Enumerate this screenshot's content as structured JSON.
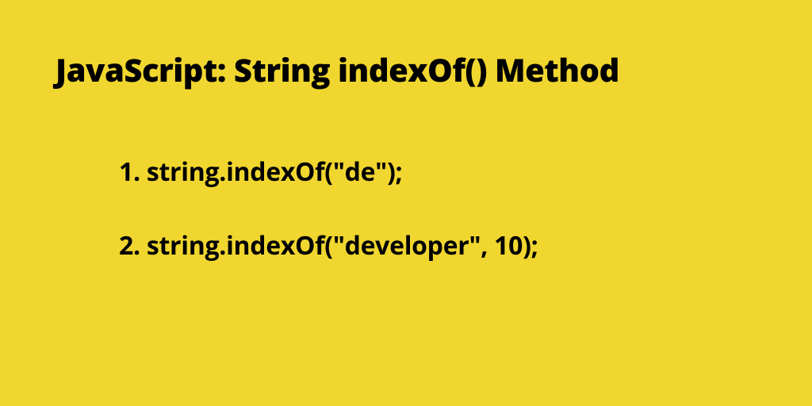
{
  "title": "JavaScript: String indexOf() Method",
  "examples": [
    "1. string.indexOf(\"de\");",
    "2. string.indexOf(\"developer\", 10);"
  ]
}
